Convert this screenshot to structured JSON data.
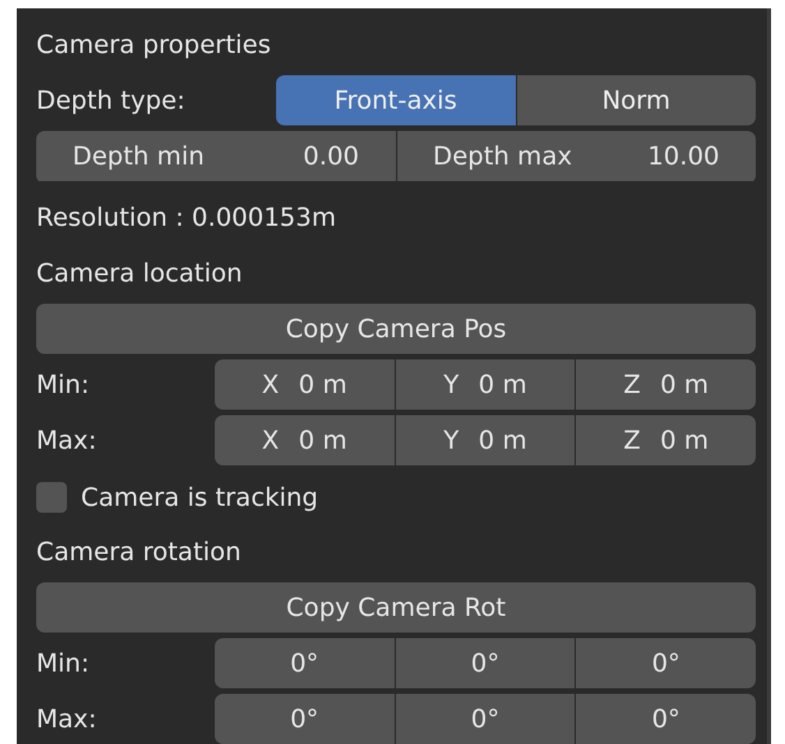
{
  "panel": {
    "title": "Camera properties",
    "depth_type": {
      "label": "Depth type:",
      "options": [
        {
          "label": "Front-axis",
          "selected": true
        },
        {
          "label": "Norm",
          "selected": false
        }
      ]
    },
    "depth_range": [
      {
        "label": "Depth min",
        "value": "0.00"
      },
      {
        "label": "Depth max",
        "value": "10.00"
      }
    ],
    "resolution": "Resolution : 0.000153m",
    "location": {
      "heading": "Camera location",
      "button": "Copy Camera Pos",
      "rows": [
        {
          "label": "Min:",
          "fields": [
            {
              "axis": "X",
              "value": "0 m"
            },
            {
              "axis": "Y",
              "value": "0 m"
            },
            {
              "axis": "Z",
              "value": "0 m"
            }
          ]
        },
        {
          "label": "Max:",
          "fields": [
            {
              "axis": "X",
              "value": "0 m"
            },
            {
              "axis": "Y",
              "value": "0 m"
            },
            {
              "axis": "Z",
              "value": "0 m"
            }
          ]
        }
      ]
    },
    "tracking": {
      "label": "Camera is tracking",
      "checked": false
    },
    "rotation": {
      "heading": "Camera rotation",
      "button": "Copy Camera Rot",
      "rows": [
        {
          "label": "Min:",
          "fields": [
            {
              "value": "0°"
            },
            {
              "value": "0°"
            },
            {
              "value": "0°"
            }
          ]
        },
        {
          "label": "Max:",
          "fields": [
            {
              "value": "0°"
            },
            {
              "value": "0°"
            },
            {
              "value": "0°"
            }
          ]
        }
      ]
    }
  }
}
